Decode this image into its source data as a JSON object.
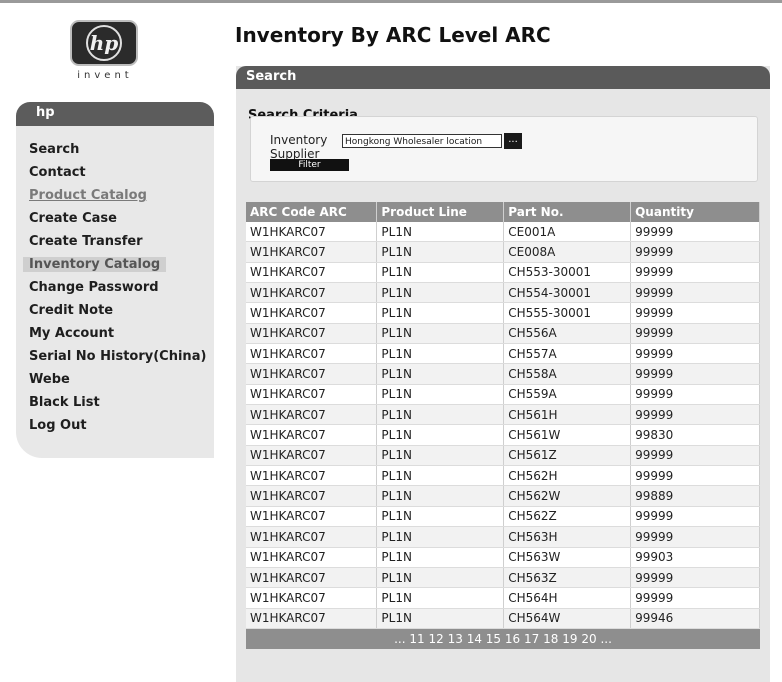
{
  "brand": {
    "logo_mark": "hp",
    "tagline": "invent"
  },
  "sidebar": {
    "title": "hp",
    "items": [
      {
        "label": "Search"
      },
      {
        "label": "Contact"
      },
      {
        "label": "Product Catalog"
      },
      {
        "label": "Create Case"
      },
      {
        "label": "Create Transfer"
      },
      {
        "label": "Inventory Catalog"
      },
      {
        "label": "Change Password"
      },
      {
        "label": "Credit Note"
      },
      {
        "label": "My Account"
      },
      {
        "label": "Serial No History(China)"
      },
      {
        "label": "Webe"
      },
      {
        "label": "Black List"
      },
      {
        "label": "Log Out"
      }
    ]
  },
  "page": {
    "title": "Inventory By ARC Level ARC"
  },
  "search": {
    "panel_title": "Search",
    "criteria_title": "Search Criteria",
    "supplier_label": "Inventory Supplier",
    "supplier_value": "Hongkong Wholesaler location",
    "browse_label": "...",
    "filter_label": "Filter"
  },
  "table": {
    "headers": [
      "ARC Code ARC",
      "Product Line",
      "Part No.",
      "Quantity"
    ],
    "rows": [
      [
        "W1HKARC07",
        "PL1N",
        "CE001A",
        "99999"
      ],
      [
        "W1HKARC07",
        "PL1N",
        "CE008A",
        "99999"
      ],
      [
        "W1HKARC07",
        "PL1N",
        "CH553-30001",
        "99999"
      ],
      [
        "W1HKARC07",
        "PL1N",
        "CH554-30001",
        "99999"
      ],
      [
        "W1HKARC07",
        "PL1N",
        "CH555-30001",
        "99999"
      ],
      [
        "W1HKARC07",
        "PL1N",
        "CH556A",
        "99999"
      ],
      [
        "W1HKARC07",
        "PL1N",
        "CH557A",
        "99999"
      ],
      [
        "W1HKARC07",
        "PL1N",
        "CH558A",
        "99999"
      ],
      [
        "W1HKARC07",
        "PL1N",
        "CH559A",
        "99999"
      ],
      [
        "W1HKARC07",
        "PL1N",
        "CH561H",
        "99999"
      ],
      [
        "W1HKARC07",
        "PL1N",
        "CH561W",
        "99830"
      ],
      [
        "W1HKARC07",
        "PL1N",
        "CH561Z",
        "99999"
      ],
      [
        "W1HKARC07",
        "PL1N",
        "CH562H",
        "99999"
      ],
      [
        "W1HKARC07",
        "PL1N",
        "CH562W",
        "99889"
      ],
      [
        "W1HKARC07",
        "PL1N",
        "CH562Z",
        "99999"
      ],
      [
        "W1HKARC07",
        "PL1N",
        "CH563H",
        "99999"
      ],
      [
        "W1HKARC07",
        "PL1N",
        "CH563W",
        "99903"
      ],
      [
        "W1HKARC07",
        "PL1N",
        "CH563Z",
        "99999"
      ],
      [
        "W1HKARC07",
        "PL1N",
        "CH564H",
        "99999"
      ],
      [
        "W1HKARC07",
        "PL1N",
        "CH564W",
        "99946"
      ]
    ]
  },
  "pager": {
    "prefix": "...",
    "pages": [
      "11",
      "12",
      "13",
      "14",
      "15",
      "16",
      "17",
      "18",
      "19",
      "20"
    ],
    "suffix": "..."
  }
}
